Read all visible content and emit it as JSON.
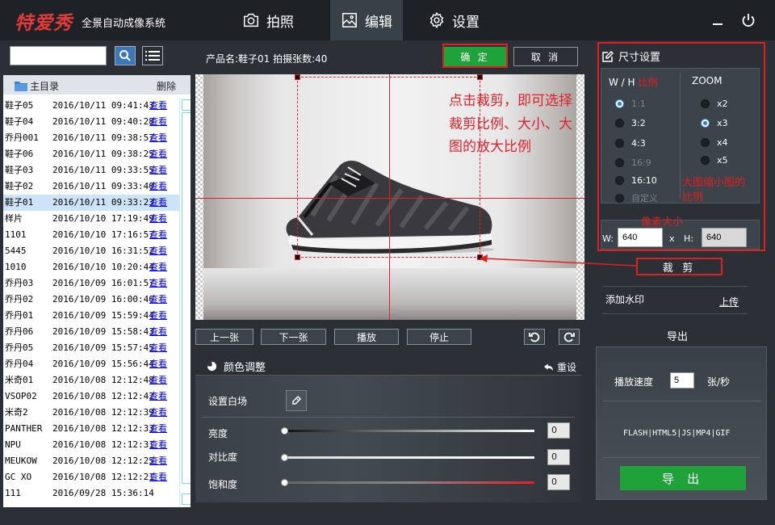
{
  "header": {
    "logo": "特爱秀",
    "subtitle": "全景自动成像系统",
    "tabs": [
      {
        "label": "拍照",
        "icon": "camera-icon"
      },
      {
        "label": "编辑",
        "icon": "image-icon",
        "active": true
      },
      {
        "label": "设置",
        "icon": "gear-icon"
      }
    ]
  },
  "sidebar": {
    "search_value": "",
    "root_label": "主目录",
    "delete_label": "删除",
    "view_label": "查看",
    "rows": [
      {
        "name": "鞋子05",
        "date": "2016/10/11 09:41:43"
      },
      {
        "name": "鞋子04",
        "date": "2016/10/11 09:40:28"
      },
      {
        "name": "乔丹001",
        "date": "2016/10/11 09:38:57"
      },
      {
        "name": "鞋子06",
        "date": "2016/10/11 09:38:25"
      },
      {
        "name": "鞋子03",
        "date": "2016/10/11 09:33:55"
      },
      {
        "name": "鞋子02",
        "date": "2016/10/11 09:33:40"
      },
      {
        "name": "鞋子01",
        "date": "2016/10/11 09:33:23",
        "selected": true
      },
      {
        "name": "样片",
        "date": "2016/10/10 17:19:49"
      },
      {
        "name": "1101",
        "date": "2016/10/10 17:16:57"
      },
      {
        "name": "5445",
        "date": "2016/10/10 16:31:52"
      },
      {
        "name": "1010",
        "date": "2016/10/10 10:20:44"
      },
      {
        "name": "乔丹03",
        "date": "2016/10/09 16:01:57"
      },
      {
        "name": "乔丹02",
        "date": "2016/10/09 16:00:46"
      },
      {
        "name": "乔丹01",
        "date": "2016/10/09 15:59:44"
      },
      {
        "name": "乔丹06",
        "date": "2016/10/09 15:58:43"
      },
      {
        "name": "乔丹05",
        "date": "2016/10/09 15:57:45"
      },
      {
        "name": "乔丹04",
        "date": "2016/10/09 15:56:44"
      },
      {
        "name": "米奇01",
        "date": "2016/10/08 12:12:48"
      },
      {
        "name": "VSOP02",
        "date": "2016/10/08 12:12:42"
      },
      {
        "name": "米奇2",
        "date": "2016/10/08 12:12:39"
      },
      {
        "name": "PANTHER",
        "date": "2016/10/08 12:12:33"
      },
      {
        "name": "NPU",
        "date": "2016/10/08 12:12:31"
      },
      {
        "name": "MEUKOW",
        "date": "2016/10/08 12:12:25"
      },
      {
        "name": "GC XO",
        "date": "2016/10/08 12:12:21"
      },
      {
        "name": "111",
        "date": "2016/09/28 15:36:14",
        "no_view": true
      }
    ]
  },
  "editor": {
    "product_label": "产品名:鞋子01  拍摄张数:40",
    "confirm_label": "确 定",
    "cancel_label": "取 消",
    "annotation": "点击裁剪，即可选择裁剪比例、大小、大图的放大比例",
    "controls": {
      "prev": "上一张",
      "next": "下一张",
      "play": "播放",
      "stop": "停止"
    }
  },
  "color_adjust": {
    "title": "颜色调整",
    "reset_label": "重设",
    "white_balance_label": "设置白场",
    "sliders": [
      {
        "label": "亮度",
        "value": "0",
        "fraction": 0
      },
      {
        "label": "对比度",
        "value": "0",
        "fraction": 0
      },
      {
        "label": "饱和度",
        "value": "0",
        "fraction": 0
      }
    ]
  },
  "size_settings": {
    "title": "尺寸设置",
    "wh_label": "W / H",
    "ratio_label": "比例",
    "zoom_label": "ZOOM",
    "ratios": [
      {
        "label": "1:1",
        "checked": true,
        "dim": true
      },
      {
        "label": "3:2"
      },
      {
        "label": "4:3"
      },
      {
        "label": "16:9",
        "dim": true
      },
      {
        "label": "16:10"
      },
      {
        "label": "自定义",
        "dim": true
      }
    ],
    "zooms": [
      {
        "label": "x2"
      },
      {
        "label": "x3",
        "checked": true
      },
      {
        "label": "x4"
      },
      {
        "label": "x5"
      }
    ],
    "zoom_note": "大图缩小图的比例",
    "pixel_note": "像素大小",
    "w_label": "W:",
    "x_label": "x",
    "h_label": "H:",
    "width": "640",
    "height": "640",
    "crop_label": "裁 剪"
  },
  "watermark": {
    "label": "添加水印",
    "upload_label": "上传"
  },
  "export": {
    "title": "导出",
    "speed_label": "播放速度",
    "speed_value": "5",
    "speed_unit": "张/秒",
    "formats": "FLASH|HTML5|JS|MP4|GIF",
    "button_label": "导 出"
  },
  "colors": {
    "accent_green": "#1fa23a",
    "annotation_red": "#e02020",
    "link_blue": "#0000ee"
  }
}
